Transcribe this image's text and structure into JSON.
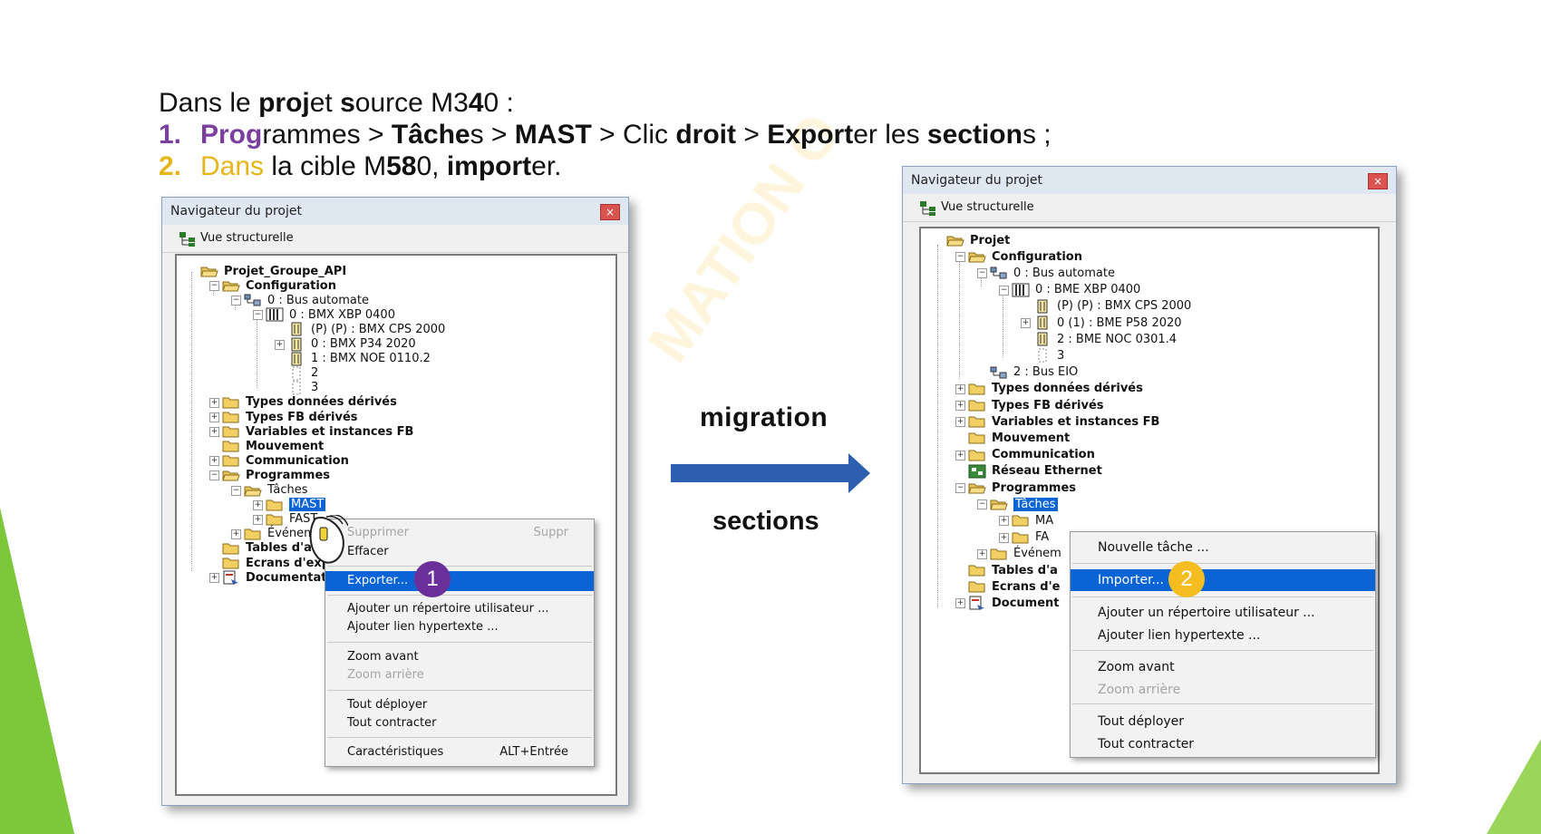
{
  "instructions": {
    "line0": {
      "a": "Dans le ",
      "b": "proj",
      "c": "et ",
      "d": "s",
      "e": "ource M3",
      "f": "4",
      "g": "0 :"
    },
    "line1": {
      "num": "1.",
      "a": "Prog",
      "b": "rammes > ",
      "c": "Tâche",
      "d": "s > ",
      "e": "MAST",
      "f": " > Clic ",
      "g": "droit",
      "h": " > ",
      "i": "Export",
      "j": "er les ",
      "k": "section",
      "l": "s ;"
    },
    "line2": {
      "num": "2.",
      "a": "Dans",
      "b": " la cible M",
      "c": "58",
      "d": "0, ",
      "e": "import",
      "f": "er."
    }
  },
  "watermark": "MATION O",
  "migration": {
    "label": "migration",
    "sublabel": "sections"
  },
  "colors": {
    "purple": "#7b3fa0",
    "gold": "#e5b51a",
    "arrow": "#2d5fb0",
    "selection": "#0a64d6",
    "green": "#7dc73a"
  },
  "left_window": {
    "title": "Navigateur du projet",
    "close": "×",
    "toolbar_label": "Vue structurelle",
    "tree": [
      {
        "label": "Projet_Groupe_API",
        "bold": true,
        "icon": "folder-open-icon"
      },
      {
        "label": "Configuration",
        "bold": true,
        "icon": "folder-open-icon"
      },
      {
        "label": "0 : Bus automate",
        "icon": "bus-icon"
      },
      {
        "label": "0 : BMX XBP 0400",
        "icon": "rack-icon"
      },
      {
        "label": "(P) (P) : BMX CPS 2000",
        "icon": "module-icon"
      },
      {
        "label": "0 : BMX P34 2020",
        "icon": "module-icon"
      },
      {
        "label": "1 : BMX NOE 0110.2",
        "icon": "module-icon"
      },
      {
        "label": "2",
        "icon": "slot-icon"
      },
      {
        "label": "3",
        "icon": "slot-icon"
      },
      {
        "label": "Types données dérivés",
        "bold": true,
        "icon": "folder-icon"
      },
      {
        "label": "Types FB dérivés",
        "bold": true,
        "icon": "folder-icon"
      },
      {
        "label": "Variables et instances FB",
        "bold": true,
        "icon": "folder-icon"
      },
      {
        "label": "Mouvement",
        "bold": true,
        "icon": "folder-icon"
      },
      {
        "label": "Communication",
        "bold": true,
        "icon": "folder-icon"
      },
      {
        "label": "Programmes",
        "bold": true,
        "icon": "folder-open-icon"
      },
      {
        "label": "Tâches",
        "icon": "folder-open-icon"
      },
      {
        "label": "MAST",
        "icon": "folder-icon",
        "selected": true
      },
      {
        "label": "FAST",
        "icon": "folder-icon"
      },
      {
        "label": "Événem",
        "icon": "folder-icon"
      },
      {
        "label": "Tables d'an",
        "bold": true,
        "icon": "folder-icon"
      },
      {
        "label": "Ecrans d'expl",
        "bold": true,
        "icon": "folder-icon"
      },
      {
        "label": "Documentati",
        "bold": true,
        "icon": "doc-icon"
      }
    ],
    "menu": [
      {
        "label": "Supprimer",
        "shortcut": "Suppr",
        "disabled": true
      },
      {
        "label": "Effacer"
      },
      {
        "label": "Exporter...",
        "active": true
      },
      {
        "label": "Ajouter un répertoire utilisateur ..."
      },
      {
        "label": "Ajouter lien hypertexte ..."
      },
      {
        "label": "Zoom avant"
      },
      {
        "label": "Zoom arrière",
        "disabled": true
      },
      {
        "label": "Tout déployer"
      },
      {
        "label": "Tout contracter"
      },
      {
        "label": "Caractéristiques",
        "shortcut": "ALT+Entrée"
      }
    ],
    "badge": "1"
  },
  "right_window": {
    "title": "Navigateur du projet",
    "close": "×",
    "toolbar_label": "Vue structurelle",
    "tree": [
      {
        "label": "Projet",
        "bold": true,
        "icon": "folder-open-icon"
      },
      {
        "label": "Configuration",
        "bold": true,
        "icon": "folder-open-icon"
      },
      {
        "label": "0 : Bus automate",
        "icon": "bus-icon"
      },
      {
        "label": "0 : BME XBP 0400",
        "icon": "rack-icon"
      },
      {
        "label": "(P) (P) : BMX CPS 2000",
        "icon": "module-icon"
      },
      {
        "label": "0 (1) : BME P58 2020",
        "icon": "module-icon"
      },
      {
        "label": "2 : BME NOC 0301.4",
        "icon": "module-icon"
      },
      {
        "label": "3",
        "icon": "slot-icon"
      },
      {
        "label": "2 : Bus EIO",
        "icon": "bus-icon"
      },
      {
        "label": "Types données dérivés",
        "bold": true,
        "icon": "folder-icon"
      },
      {
        "label": "Types FB dérivés",
        "bold": true,
        "icon": "folder-icon"
      },
      {
        "label": "Variables et instances FB",
        "bold": true,
        "icon": "folder-icon"
      },
      {
        "label": "Mouvement",
        "bold": true,
        "icon": "folder-icon"
      },
      {
        "label": "Communication",
        "bold": true,
        "icon": "folder-icon"
      },
      {
        "label": "Réseau Ethernet",
        "bold": true,
        "icon": "network-icon"
      },
      {
        "label": "Programmes",
        "bold": true,
        "icon": "folder-open-icon"
      },
      {
        "label": "Tâches",
        "icon": "folder-open-icon",
        "selected": true
      },
      {
        "label": "MA",
        "icon": "folder-icon"
      },
      {
        "label": "FA",
        "icon": "folder-icon"
      },
      {
        "label": "Événem",
        "icon": "folder-icon"
      },
      {
        "label": "Tables d'a",
        "bold": true,
        "icon": "folder-icon"
      },
      {
        "label": "Ecrans d'e",
        "bold": true,
        "icon": "folder-icon"
      },
      {
        "label": "Document",
        "bold": true,
        "icon": "doc-icon"
      }
    ],
    "menu": [
      {
        "label": "Nouvelle tâche ..."
      },
      {
        "label": "Importer...",
        "active": true
      },
      {
        "label": "Ajouter un répertoire utilisateur ..."
      },
      {
        "label": "Ajouter lien hypertexte ..."
      },
      {
        "label": "Zoom avant"
      },
      {
        "label": "Zoom arrière",
        "disabled": true
      },
      {
        "label": "Tout déployer"
      },
      {
        "label": "Tout contracter"
      }
    ],
    "badge": "2"
  }
}
